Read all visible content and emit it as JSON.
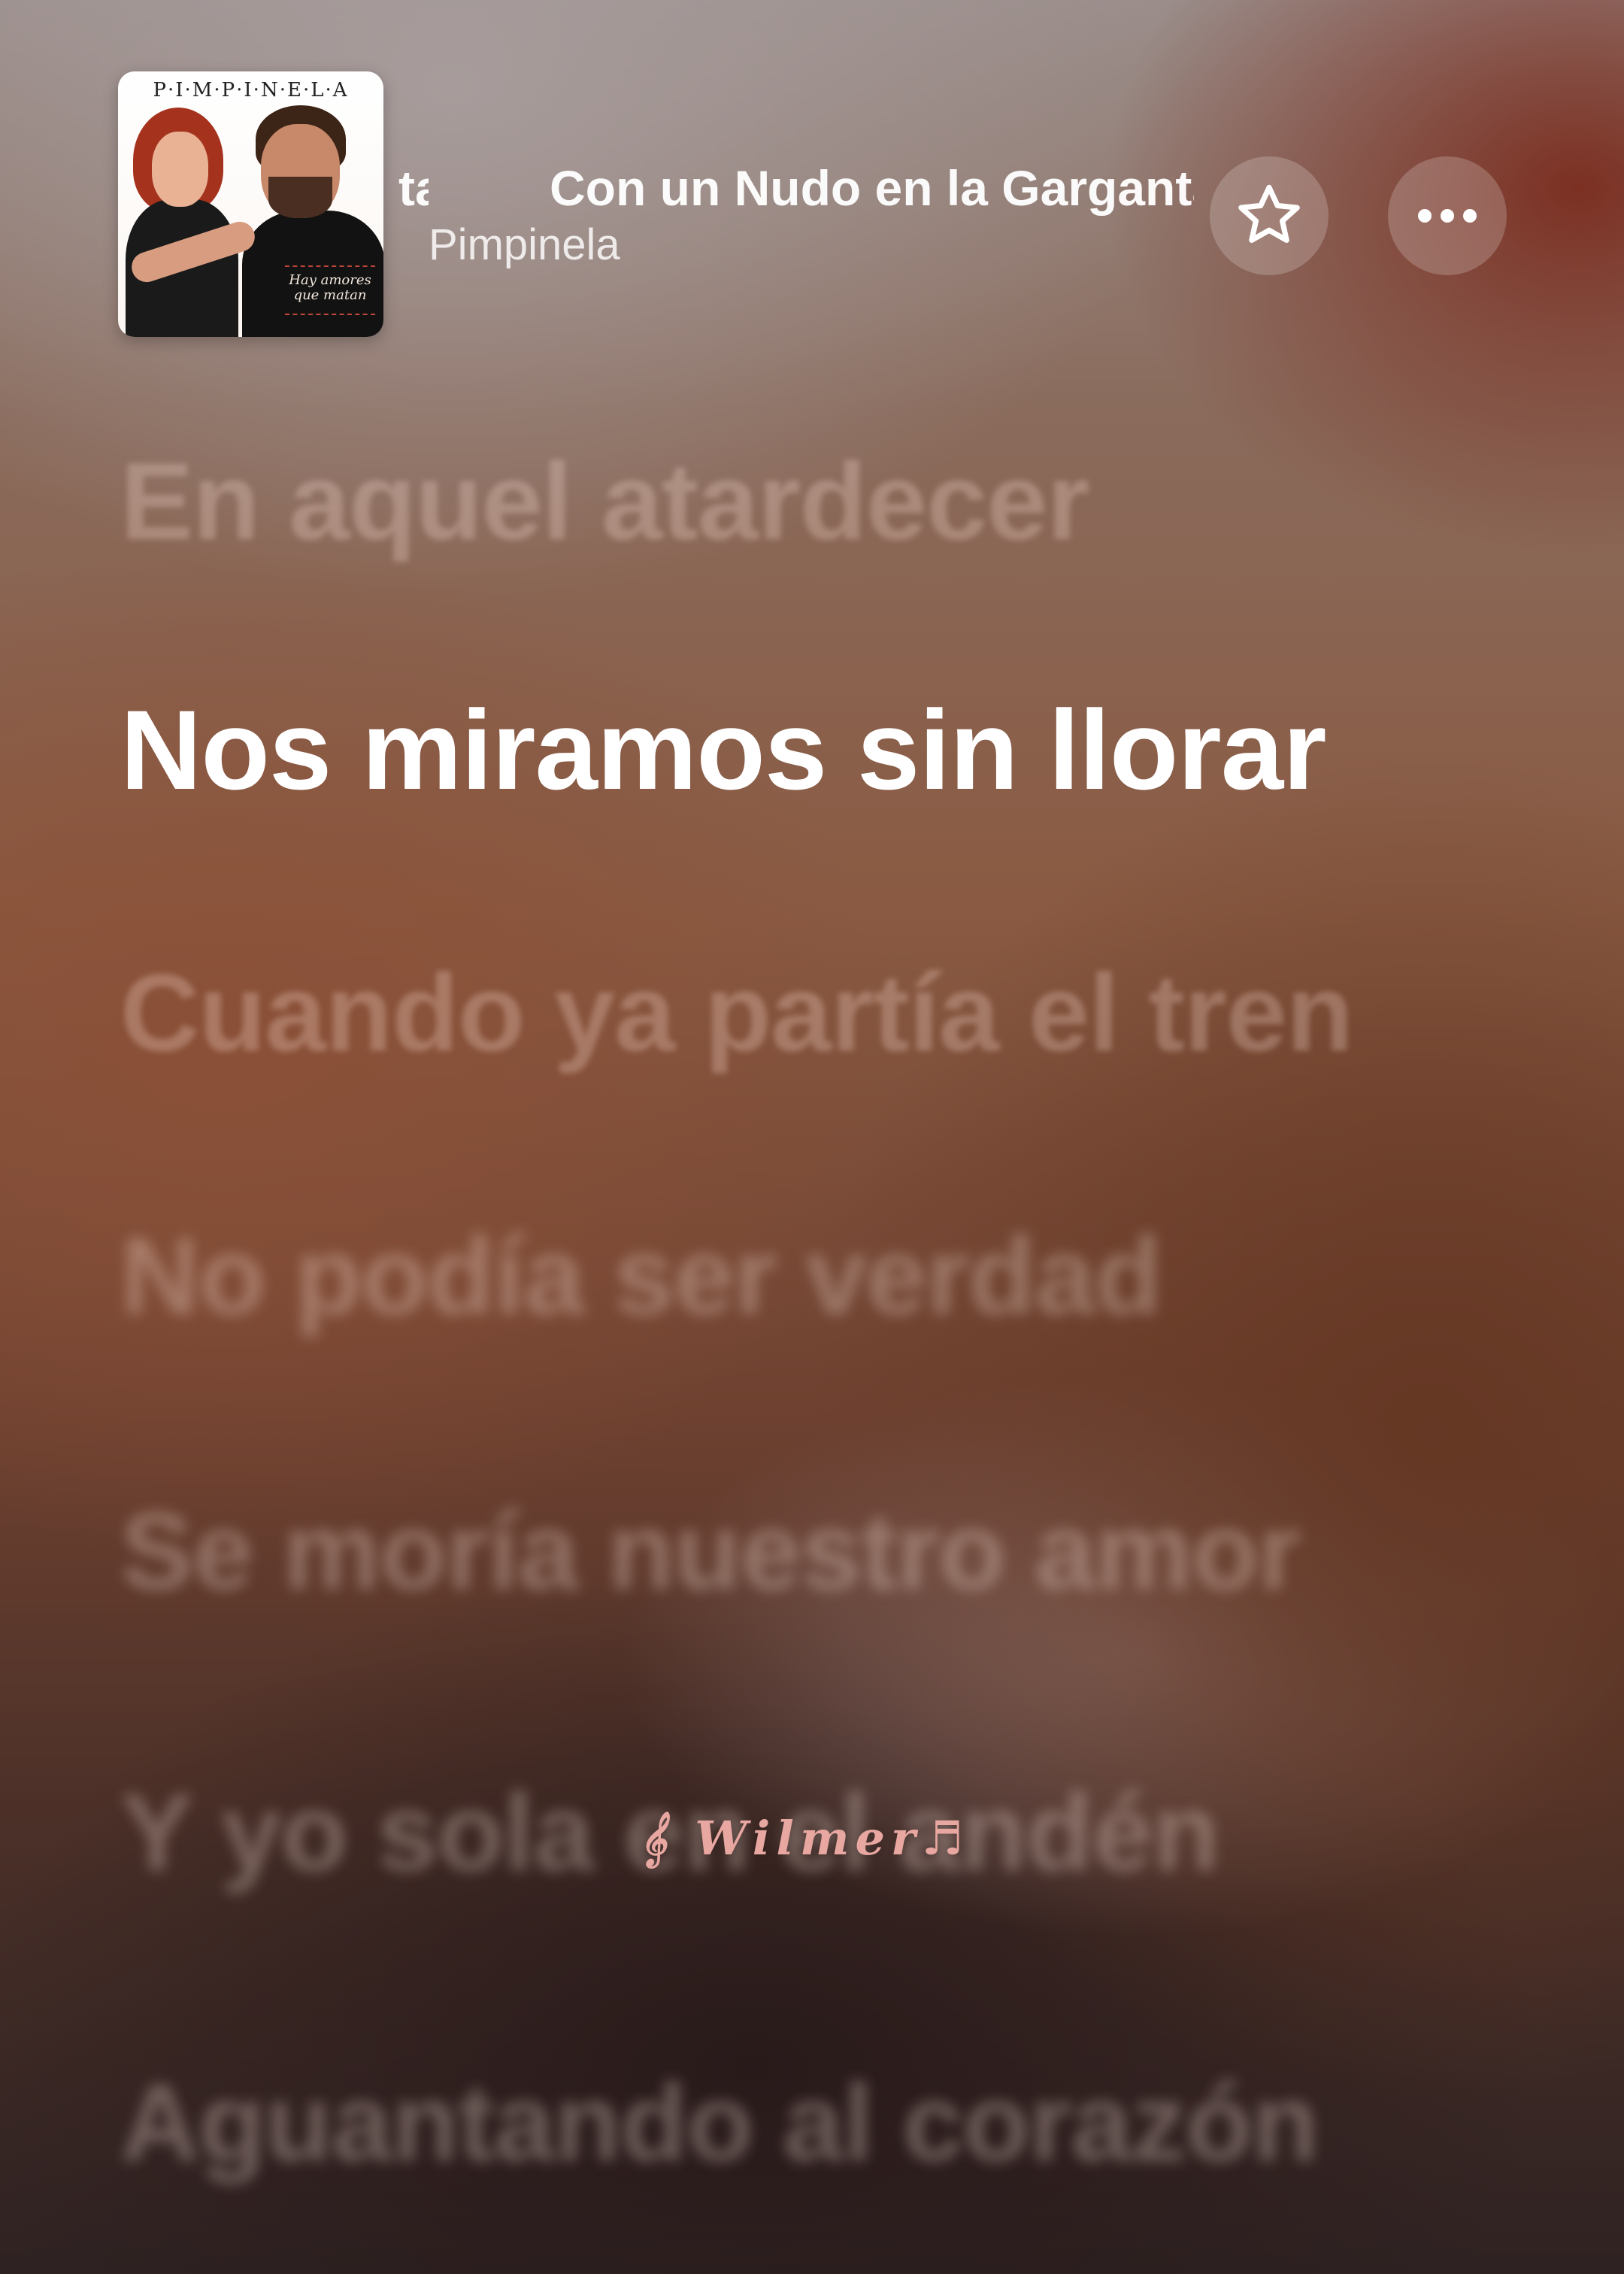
{
  "now_playing": {
    "title_fragment": "ta",
    "title": "Con un Nudo en la Garganta",
    "artist": "Pimpinela",
    "album_art": {
      "band_text": "P·I·M·P·I·N·E·L·A",
      "caption_line1": "Hay amores",
      "caption_line2": "que matan"
    }
  },
  "controls": {
    "favorite_icon": "star-icon",
    "more_icon": "ellipsis-icon"
  },
  "lyrics": [
    {
      "text": "En aquel atardecer",
      "state": "past"
    },
    {
      "text": "Nos miramos sin llorar",
      "state": "current"
    },
    {
      "text": "Cuando ya partía el tren",
      "state": "upcoming"
    },
    {
      "text": "No podía ser verdad",
      "state": "upcoming"
    },
    {
      "text": "Se moría nuestro amor",
      "state": "upcoming"
    },
    {
      "text": "Y yo sola en el andén",
      "state": "upcoming"
    },
    {
      "text": "Aguantando al corazón",
      "state": "upcoming"
    }
  ],
  "watermark": "𝄞 Wilmer♬"
}
